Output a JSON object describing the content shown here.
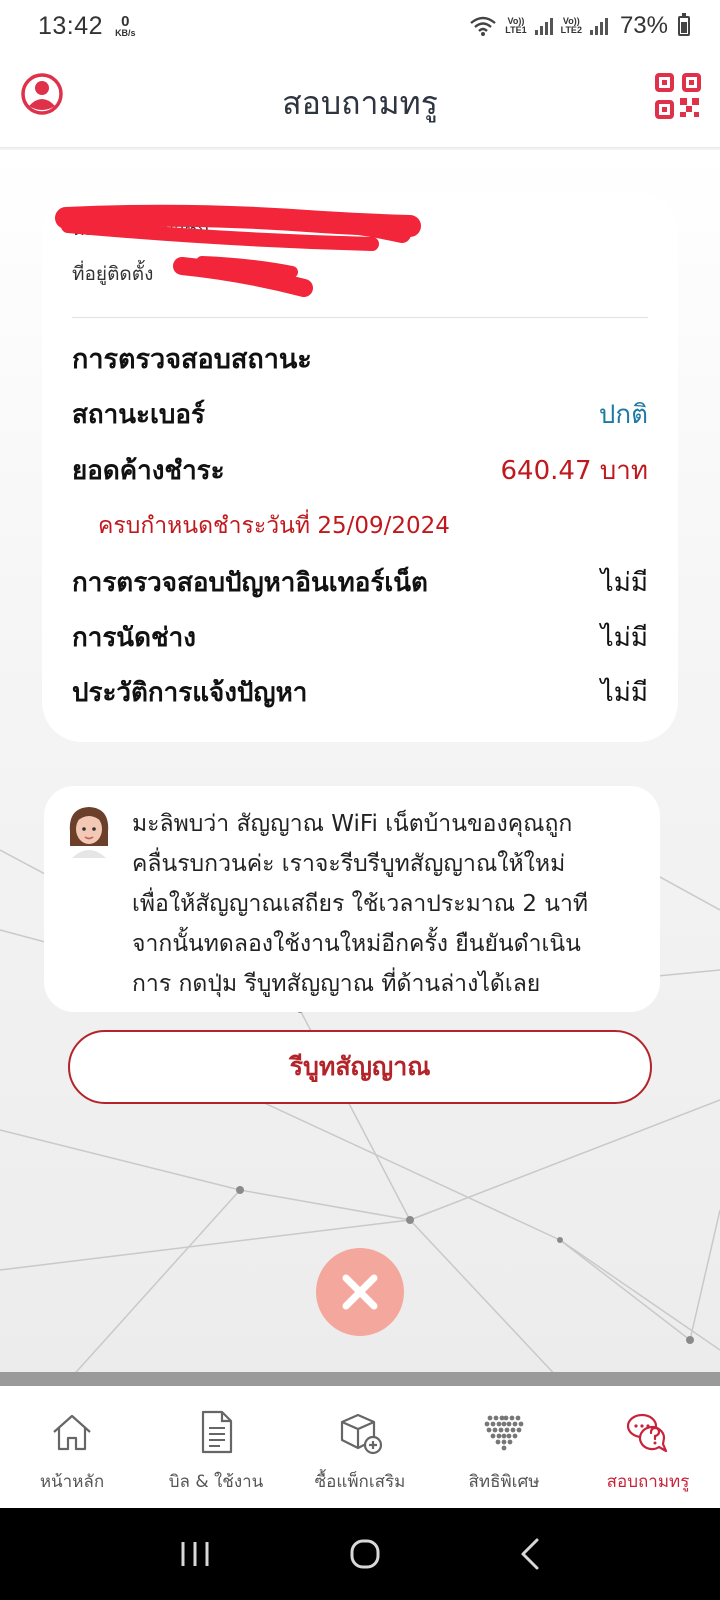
{
  "status_bar": {
    "time": "13:42",
    "data_rate": "0",
    "data_rate_unit": "KB/s",
    "sim1_label": "Vo))\nLTE1",
    "sim2_label": "Vo))\nLTE2",
    "battery": "73%"
  },
  "header": {
    "title": "สอบถามทรู",
    "profile_icon": "profile-icon",
    "qr_icon": "qr-code-icon"
  },
  "account": {
    "member_label": "หมายเลขสมาชิก",
    "address_label": "ที่อยู่ติดตั้ง"
  },
  "status_check": {
    "title": "การตรวจสอบสถานะ",
    "rows": [
      {
        "label": "สถานะเบอร์",
        "value": "ปกติ"
      },
      {
        "label": "ยอดค้างชำระ",
        "value": "640.47 บาท"
      },
      {
        "label": "การตรวจสอบปัญหาอินเทอร์เน็ต",
        "value": "ไม่มี"
      },
      {
        "label": "การนัดช่าง",
        "value": "ไม่มี"
      },
      {
        "label": "ประวัติการแจ้งปัญหา",
        "value": "ไม่มี"
      }
    ],
    "due_date_text": "ครบกำหนดชำระวันที่ 25/09/2024"
  },
  "chat": {
    "lines": [
      "มะลิพบว่า สัญญาณ WiFi เน็ตบ้านของคุณถูก",
      "คลื่นรบกวนค่ะ เราจะรีบรีบูทสัญญาณให้ใหม่",
      "เพื่อให้สัญญาณเสถียร ใช้เวลาประมาณ 2 นาที",
      "จากนั้นทดลองใช้งานใหม่อีกครั้ง ยืนยันดำเนิน",
      "การ กดปุ่ม รีบูทสัญญาณ ที่ด้านล่างได้เลย"
    ]
  },
  "actions": {
    "reboot_label": "รีบูทสัญญาณ"
  },
  "bottom_nav": [
    {
      "label": "หน้าหลัก",
      "icon": "home-icon"
    },
    {
      "label": "บิล & ใช้งาน",
      "icon": "bill-icon"
    },
    {
      "label": "ซื้อแพ็กเสริม",
      "icon": "package-add-icon"
    },
    {
      "label": "สิทธิพิเศษ",
      "icon": "privilege-heart-icon"
    },
    {
      "label": "สอบถามทรู",
      "icon": "chat-question-icon",
      "active": true
    }
  ],
  "colors": {
    "brand_red": "#c8233a",
    "button_red": "#b3242a",
    "status_blue": "#1e7aa3",
    "close_fab": "#f4a79c"
  }
}
